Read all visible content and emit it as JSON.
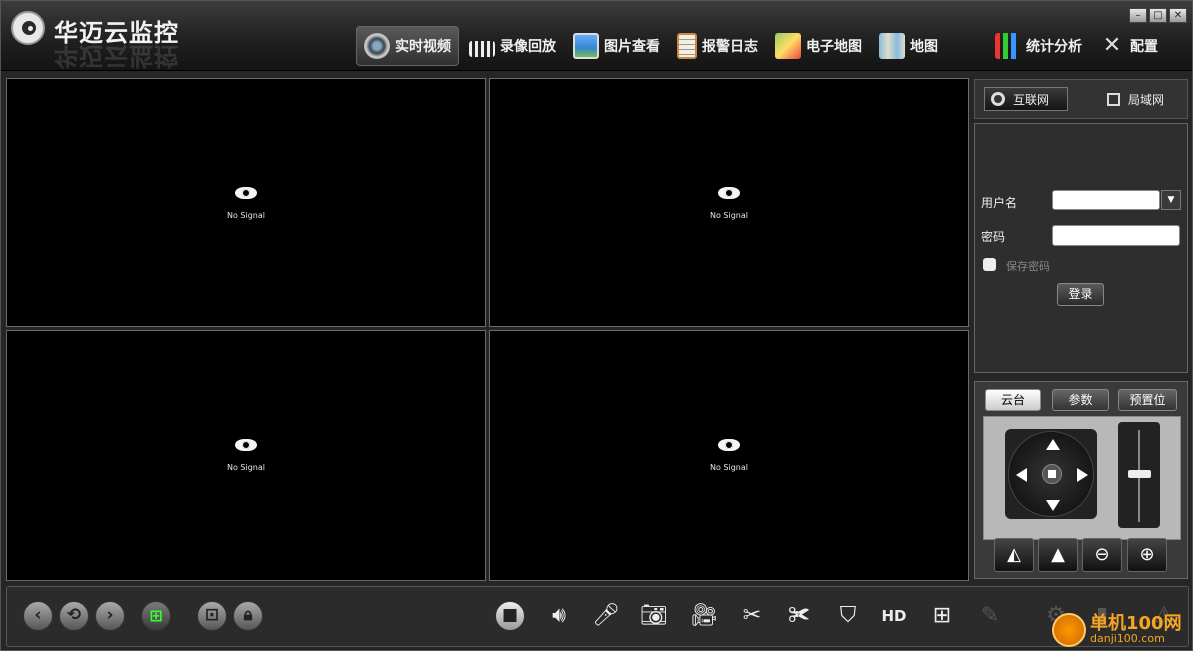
{
  "app": {
    "title": "华迈云监控"
  },
  "nav": {
    "items": [
      {
        "label": "实时视频",
        "icon": "camera-icon",
        "active": true
      },
      {
        "label": "录像回放",
        "icon": "film-clapper-icon"
      },
      {
        "label": "图片查看",
        "icon": "picture-icon"
      },
      {
        "label": "报警日志",
        "icon": "clipboard-icon"
      },
      {
        "label": "电子地图",
        "icon": "map-pin-icon"
      },
      {
        "label": "地图",
        "icon": "map-icon"
      },
      {
        "label": "统计分析",
        "icon": "bar-chart-icon"
      },
      {
        "label": "配置",
        "icon": "tools-icon"
      }
    ]
  },
  "video": {
    "cells": [
      {
        "status": "No Signal"
      },
      {
        "status": "No Signal"
      },
      {
        "status": "No Signal"
      },
      {
        "status": "No Signal"
      }
    ]
  },
  "network": {
    "internet_label": "互联网",
    "lan_label": "局域网"
  },
  "login": {
    "username_label": "用户名",
    "username_value": "",
    "password_label": "密码",
    "save_password_label": "保存密码",
    "save_password_checked": false,
    "login_button": "登录"
  },
  "ptz": {
    "tabs": [
      "云台",
      "参数",
      "预置位"
    ],
    "active_tab": "云台"
  },
  "watermark": {
    "text": "单机100网",
    "url": "danji100.com"
  },
  "colors": {
    "background": "#262626",
    "video_bg": "#000000",
    "watermark": "#f5a623"
  }
}
